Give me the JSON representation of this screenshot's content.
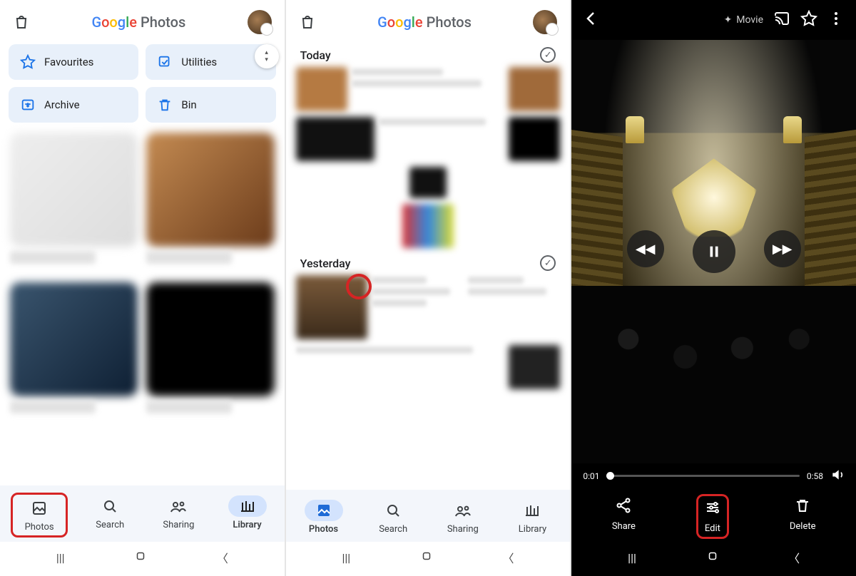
{
  "app": {
    "name": "Google Photos",
    "brand_word": "Google",
    "suffix": "Photos"
  },
  "screen1": {
    "chips": {
      "favourites": "Favourites",
      "utilities": "Utilities",
      "archive": "Archive",
      "bin": "Bin"
    },
    "nav": {
      "photos": "Photos",
      "search": "Search",
      "sharing": "Sharing",
      "library": "Library"
    },
    "highlighted_nav": "photos",
    "active_nav": "library"
  },
  "screen2": {
    "sections": {
      "today": "Today",
      "yesterday": "Yesterday"
    },
    "nav": {
      "photos": "Photos",
      "search": "Search",
      "sharing": "Sharing",
      "library": "Library"
    },
    "active_nav": "photos",
    "highlighted_thumb": "video-thumb"
  },
  "screen3": {
    "type_label": "Movie",
    "playback": {
      "current": "0:01",
      "duration": "0:58"
    },
    "actions": {
      "share": "Share",
      "edit": "Edit",
      "delete": "Delete"
    },
    "highlighted_action": "edit"
  },
  "colors": {
    "highlight": "#d62424",
    "chip_bg": "#e8f0fa",
    "accent": "#1a73e8"
  }
}
